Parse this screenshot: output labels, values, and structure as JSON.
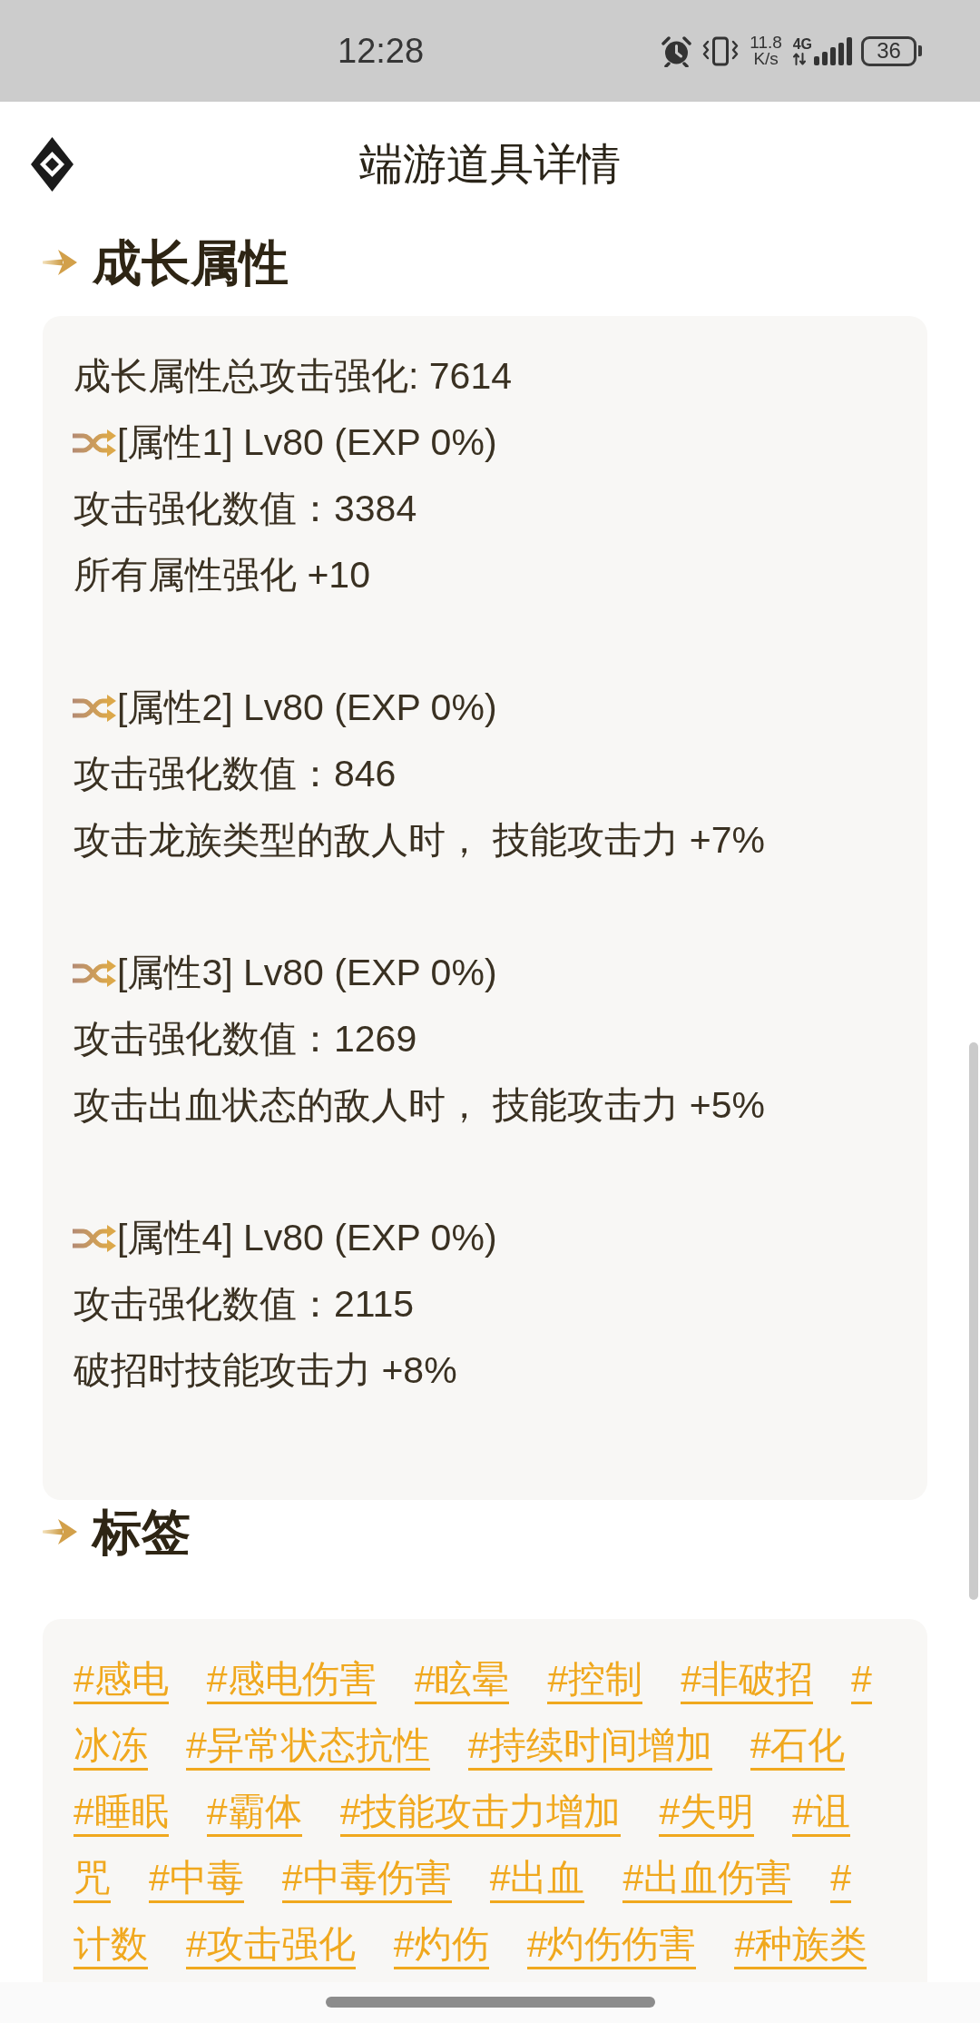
{
  "status_bar": {
    "time": "12:28",
    "speed_value": "11.8",
    "speed_unit": "K/s",
    "network_type": "4G",
    "battery": "36"
  },
  "header": {
    "title": "端游道具详情"
  },
  "growth_section": {
    "heading": "成长属性",
    "summary": "成长属性总攻击强化: 7614",
    "attributes": [
      {
        "title": "[属性1] Lv80 (EXP 0%)",
        "attack_value": "攻击强化数值：3384",
        "effect": "所有属性强化 +10"
      },
      {
        "title": "[属性2] Lv80 (EXP 0%)",
        "attack_value": "攻击强化数值：846",
        "effect": "攻击龙族类型的敌人时， 技能攻击力 +7%"
      },
      {
        "title": "[属性3] Lv80 (EXP 0%)",
        "attack_value": "攻击强化数值：1269",
        "effect": "攻击出血状态的敌人时， 技能攻击力 +5%"
      },
      {
        "title": "[属性4] Lv80 (EXP 0%)",
        "attack_value": "攻击强化数值：2115",
        "effect": "破招时技能攻击力 +8%"
      }
    ]
  },
  "tags_section": {
    "heading": "标签",
    "tags": [
      {
        "lines": [
          "#感电"
        ]
      },
      {
        "lines": [
          "#感电伤害"
        ]
      },
      {
        "lines": [
          "#眩晕"
        ]
      },
      {
        "lines": [
          "#控制"
        ]
      },
      {
        "lines": [
          "#非破招"
        ]
      },
      {
        "lines": [
          "#",
          "冰冻"
        ]
      },
      {
        "lines": [
          "#异常状态抗性"
        ]
      },
      {
        "lines": [
          "#持续时间增加"
        ]
      },
      {
        "lines": [
          "#石化"
        ]
      },
      {
        "lines": [
          "#睡眠"
        ]
      },
      {
        "lines": [
          "#霸体"
        ]
      },
      {
        "lines": [
          "#技能攻击力增加"
        ]
      },
      {
        "lines": [
          "#失明"
        ]
      },
      {
        "lines": [
          "#诅",
          "咒"
        ]
      },
      {
        "lines": [
          "#中毒"
        ]
      },
      {
        "lines": [
          "#中毒伤害"
        ]
      },
      {
        "lines": [
          "#出血"
        ]
      },
      {
        "lines": [
          "#出血伤害"
        ]
      },
      {
        "lines": [
          "#",
          "计数"
        ]
      },
      {
        "lines": [
          "#攻击强化"
        ]
      },
      {
        "lines": [
          "#灼伤"
        ]
      },
      {
        "lines": [
          "#灼伤伤害"
        ]
      },
      {
        "lines": [
          "#种族类"
        ]
      }
    ]
  }
}
